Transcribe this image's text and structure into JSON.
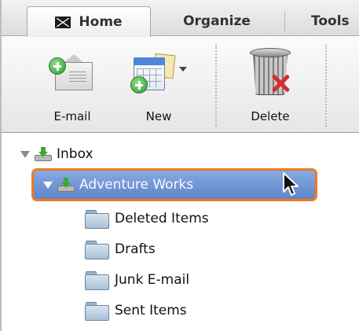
{
  "tabs": {
    "home": "Home",
    "organize": "Organize",
    "tools": "Tools"
  },
  "ribbon": {
    "email_label": "E-mail",
    "new_label": "New",
    "delete_label": "Delete"
  },
  "folders": {
    "inbox": "Inbox",
    "account": "Adventure Works",
    "items": [
      "Deleted Items",
      "Drafts",
      "Junk E-mail",
      "Sent Items"
    ]
  },
  "colors": {
    "selection": "#6e93d3",
    "highlight_border": "#f27a1a"
  }
}
